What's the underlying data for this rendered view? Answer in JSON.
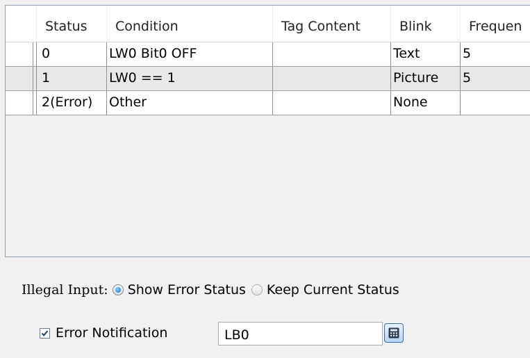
{
  "table": {
    "columns": [
      "Status",
      "Condition",
      "Tag Content",
      "Blink",
      "Frequen"
    ],
    "rows": [
      {
        "status": "0",
        "condition": "LW0 Bit0 OFF",
        "tag_content": "",
        "blink": "Text",
        "frequency": "5"
      },
      {
        "status": "1",
        "condition": "LW0 == 1",
        "tag_content": "",
        "blink": "Picture",
        "frequency": "5"
      },
      {
        "status": "2(Error)",
        "condition": "Other",
        "tag_content": "",
        "blink": "None",
        "frequency": ""
      }
    ]
  },
  "illegal_input": {
    "label": "Illegal Input:",
    "options": [
      "Show Error Status",
      "Keep Current Status"
    ],
    "selected": "Show Error Status"
  },
  "error_notification": {
    "label": "Error Notification",
    "checked": true,
    "value": "LB0"
  },
  "icons": {
    "radio_selected": "radio-selected-icon",
    "radio_unselected": "radio-unselected-icon",
    "checkbox": "checkmark-icon",
    "calc": "calculator-icon"
  },
  "colors": {
    "grid_border": "#8f9db0",
    "row_alt": "#e8e8e8",
    "radio_selected": "#1f6fc4"
  }
}
